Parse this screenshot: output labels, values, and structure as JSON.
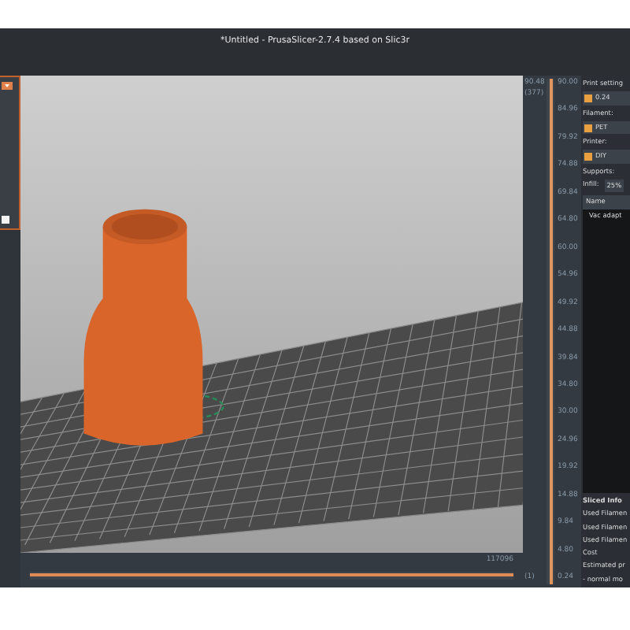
{
  "window": {
    "title": "*Untitled - PrusaSlicer-2.7.4 based on Slic3r"
  },
  "layer_slider": {
    "top_value": "90.48",
    "top_layer": "(377)",
    "bottom_layer": "(1)",
    "level": 1,
    "labels": [
      "90.00",
      "84.96",
      "79.92",
      "74.88",
      "69.84",
      "64.80",
      "60.00",
      "54.96",
      "49.92",
      "44.88",
      "39.84",
      "34.80",
      "30.00",
      "24.96",
      "19.92",
      "14.88",
      "9.84",
      "4.80",
      "0.24"
    ]
  },
  "move_slider": {
    "value": "117096",
    "level": 1
  },
  "right_panel": {
    "print_settings_label": "Print setting",
    "print_settings_value": "0.24",
    "filament_label": "Filament:",
    "filament_value": "PET",
    "printer_label": "Printer:",
    "printer_value": "DIY",
    "supports_label": "Supports:",
    "infill_label": "Infill:",
    "infill_value": "25%",
    "object_list_header": "Name",
    "objects": [
      {
        "name": "Vac adapt",
        "selected": false
      }
    ],
    "sliced_info": {
      "title": "Sliced Info",
      "rows": [
        "Used Filamen",
        "Used Filamen",
        "Used Filamen",
        "Cost",
        "Estimated pr",
        "- normal mo"
      ]
    }
  }
}
